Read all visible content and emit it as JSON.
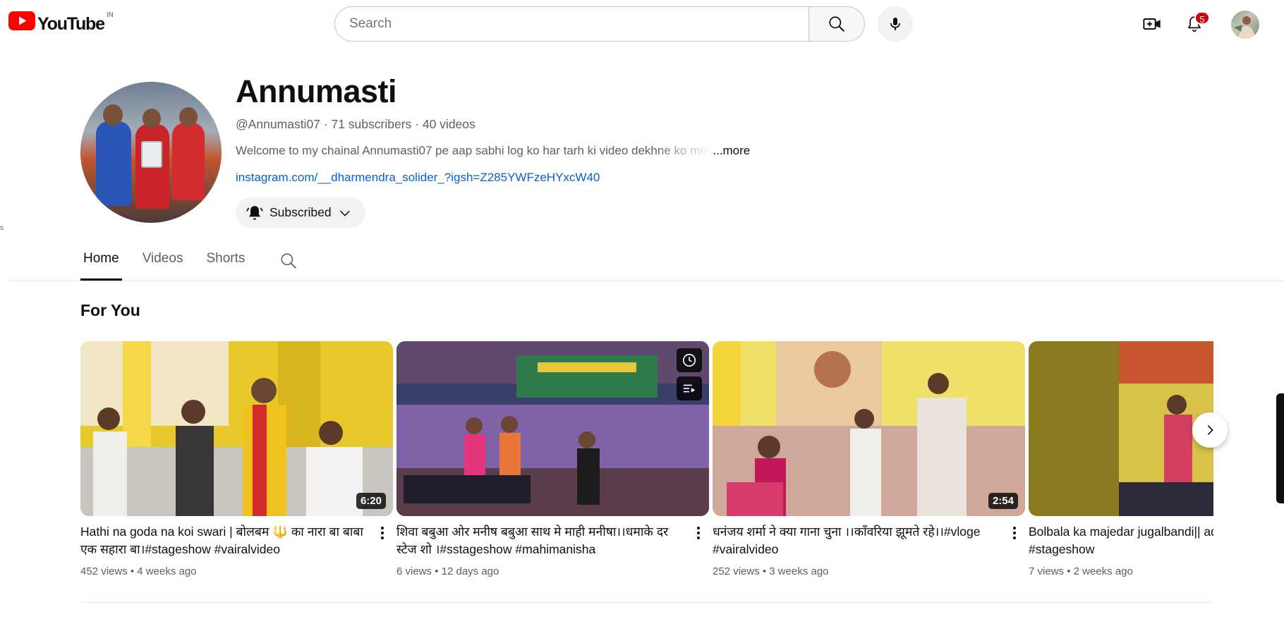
{
  "header": {
    "logo_text": "YouTube",
    "country_code": "IN",
    "search": {
      "placeholder": "Search",
      "value": ""
    },
    "icons": {
      "search": "search-icon",
      "mic": "microphone-icon",
      "create": "video-camera-plus-icon",
      "notifications": "bell-icon",
      "avatar": "account-avatar"
    },
    "notifications_count": "5",
    "colors": {
      "brand_red": "#ff0000",
      "badge": "#cc0000"
    }
  },
  "channel": {
    "name": "Annumasti",
    "handle": "@Annumasti07",
    "subscribers": "71 subscribers",
    "videos": "40 videos",
    "separator": " · ",
    "description": "Welcome to my chainal Annumasti07 pe aap sabhi log ko har tarh ki video dekhne ko mile",
    "more_label": "...more",
    "link": "instagram.com/__dharmendra_solider_?igsh=Z285YWFzeHYxcW40",
    "subscribe_label": "Subscribed",
    "left_fragment": "s"
  },
  "tabs": [
    {
      "label": "Home",
      "active": true
    },
    {
      "label": "Videos",
      "active": false
    },
    {
      "label": "Shorts",
      "active": false
    }
  ],
  "section": {
    "title": "For You",
    "videos": [
      {
        "title": "Hathi na goda na koi swari | बोलबम 🔱 का नारा बा बाबा एक सहारा बा।#stageshow #vairalvideo",
        "views": "452 views",
        "age": "4 weeks ago",
        "duration": "6:20"
      },
      {
        "title": "शिवा बबुआ ओर मनीष बबुआ साथ मे माही मनीषा।।धमाके दर स्टेज शो ।#sstageshow #mahimanisha",
        "views": "6 views",
        "age": "12 days ago",
        "duration": ""
      },
      {
        "title": "धनंजय शर्मा ने क्या गाना चुना ।।काँवरिया झूमते रहे।।#vloge #vairalvideo",
        "views": "252 views",
        "age": "3 weeks ago",
        "duration": "2:54"
      },
      {
        "title": "Bolbala ka majedar jugalbandi|| adhik chora||#vairal #stageshow",
        "views": "7 views",
        "age": "2 weeks ago",
        "duration": ""
      }
    ],
    "meta_separator": " • "
  }
}
